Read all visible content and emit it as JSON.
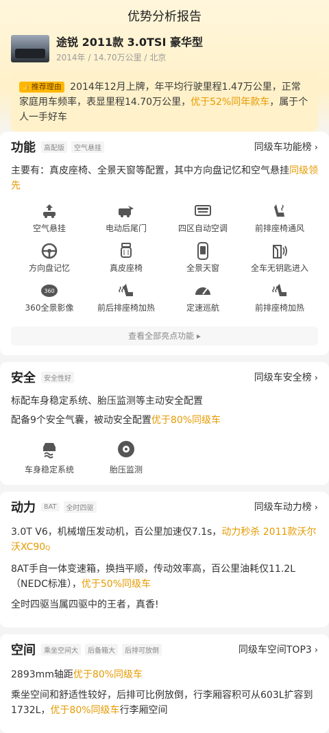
{
  "page": {
    "title": "优势分析报告"
  },
  "car": {
    "name": "途锐 2011款 3.0TSI 豪华型",
    "meta": "2014年 / 14.70万公里 / 北京"
  },
  "recommend": {
    "badge": "推荐理由",
    "text_1": "2014年12月上牌，年平均行驶里程1.47万公里，正常家庭用车频率，表显里程14.70万公里，",
    "highlight": "优于52%同年款车",
    "text_2": "，属于个人一手好车"
  },
  "function": {
    "title": "功能",
    "tags": [
      "高配版",
      "空气悬挂"
    ],
    "rank_link": "同级车功能榜",
    "desc_1": "主要有：真皮座椅、全景天窗等配置，其中方向盘记忆和空气悬挂",
    "desc_hl": "同级领先",
    "features": [
      {
        "label": "空气悬挂",
        "icon": "air-suspension-icon"
      },
      {
        "label": "电动后尾门",
        "icon": "power-tailgate-icon"
      },
      {
        "label": "四区自动空调",
        "icon": "climate-control-icon"
      },
      {
        "label": "前排座椅通风",
        "icon": "seat-ventilation-icon"
      },
      {
        "label": "方向盘记忆",
        "icon": "steering-memory-icon"
      },
      {
        "label": "真皮座椅",
        "icon": "leather-seat-icon"
      },
      {
        "label": "全景天窗",
        "icon": "panoramic-sunroof-icon"
      },
      {
        "label": "全车无钥匙进入",
        "icon": "keyless-entry-icon"
      },
      {
        "label": "360全景影像",
        "icon": "camera-360-icon"
      },
      {
        "label": "前后排座椅加热",
        "icon": "seat-heating-icon"
      },
      {
        "label": "定速巡航",
        "icon": "cruise-control-icon"
      },
      {
        "label": "前排座椅加热",
        "icon": "front-seat-heating-icon"
      }
    ],
    "more": "查看全部亮点功能 ▸"
  },
  "safety": {
    "title": "安全",
    "tags": [
      "安全性好"
    ],
    "rank_link": "同级车安全榜",
    "line_1": "标配车身稳定系统、胎压监测等主动安全配置",
    "line_2a": "配备9个安全气囊，被动安全配置",
    "line_2hl": "优于80%同级车",
    "items": [
      {
        "label": "车身稳定系统",
        "icon": "stability-control-icon"
      },
      {
        "label": "胎压监测",
        "icon": "tire-pressure-icon"
      }
    ]
  },
  "power": {
    "title": "动力",
    "tags": [
      "8AT",
      "全时四驱"
    ],
    "rank_link": "同级车动力榜",
    "p1a": "3.0T V6，机械增压发动机，百公里加速仅7.1s，",
    "p1hl": "动力秒杀 2011款沃尔沃XC90",
    "p2a": "8AT手自一体变速箱，换挡平顺，传动效率高，百公里油耗仅11.2L（NEDC标准），",
    "p2hl": "优于50%同级车",
    "p3": "全时四驱当属四驱中的王者，真香!"
  },
  "space": {
    "title": "空间",
    "tags": [
      "乘坐空间大",
      "后备箱大",
      "后排可放倒"
    ],
    "rank_link": "同级车空间TOP3",
    "p1a": "2893mm轴距",
    "p1hl": "优于80%同级车",
    "p2a": "乘坐空间和舒适性较好，后排可比例放倒，行李厢容积可从603L扩容到1732L，",
    "p2hl": "优于80%同级车",
    "p2b": "行李厢空间"
  },
  "colors": {
    "accent": "#e59a00",
    "badge": "#ffb800",
    "bg_top": "#fff6dc"
  }
}
